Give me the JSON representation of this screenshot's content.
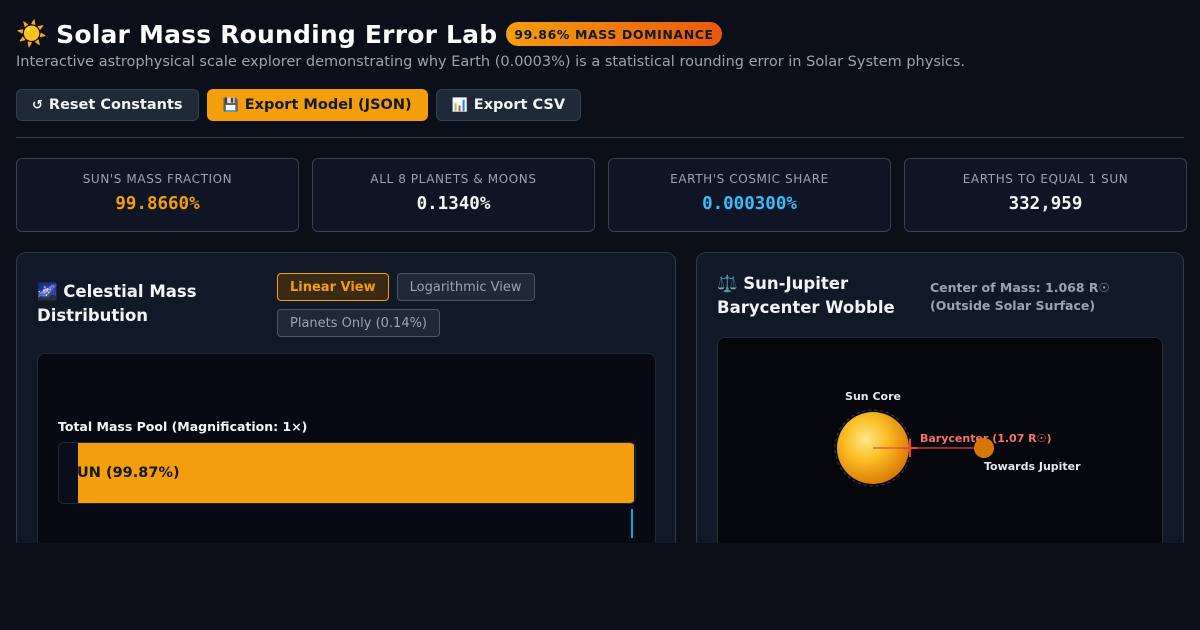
{
  "header": {
    "title_emoji": "☀️",
    "title": "Solar Mass Rounding Error Lab",
    "badge": "99.86% MASS DOMINANCE",
    "subtitle": "Interactive astrophysical scale explorer demonstrating why Earth (0.0003%) is a statistical rounding error in Solar System physics."
  },
  "toolbar": {
    "reset": {
      "icon": "↺",
      "label": "Reset Constants"
    },
    "export_json": {
      "icon": "💾",
      "label": "Export Model (JSON)"
    },
    "export_csv": {
      "icon": "📊",
      "label": "Export CSV"
    }
  },
  "stats": [
    {
      "label": "SUN'S MASS FRACTION",
      "value": "99.8660%"
    },
    {
      "label": "ALL 8 PLANETS & MOONS",
      "value": "0.1340%"
    },
    {
      "label": "EARTH'S COSMIC SHARE",
      "value": "0.000300%"
    },
    {
      "label": "EARTHS TO EQUAL 1 SUN",
      "value": "332,959"
    }
  ],
  "distribution_panel": {
    "title": "🌌 Celestial Mass Distribution",
    "views": [
      {
        "label": "Linear View",
        "active": true
      },
      {
        "label": "Logarithmic View",
        "active": false
      },
      {
        "label": "Planets Only (0.14%)",
        "active": false
      }
    ],
    "pool_label": "Total Mass Pool (Magnification: 1×)",
    "sun_bar": {
      "label": "UN (99.87%)",
      "fraction": 0.9987
    }
  },
  "wobble_panel": {
    "title": "⚖️ Sun-Jupiter Barycenter Wobble",
    "center_of_mass": "Center of Mass: 1.068 R☉ (Outside Solar Surface)",
    "labels": {
      "sun": "Sun Core",
      "barycenter": "Barycenter (1.07 R☉)",
      "jupiter": "Towards Jupiter"
    }
  },
  "colors": {
    "accent": "#f59e0b",
    "earth_blue": "#38bdf8",
    "barycenter": "#f87171",
    "background": "#0b0f19"
  }
}
